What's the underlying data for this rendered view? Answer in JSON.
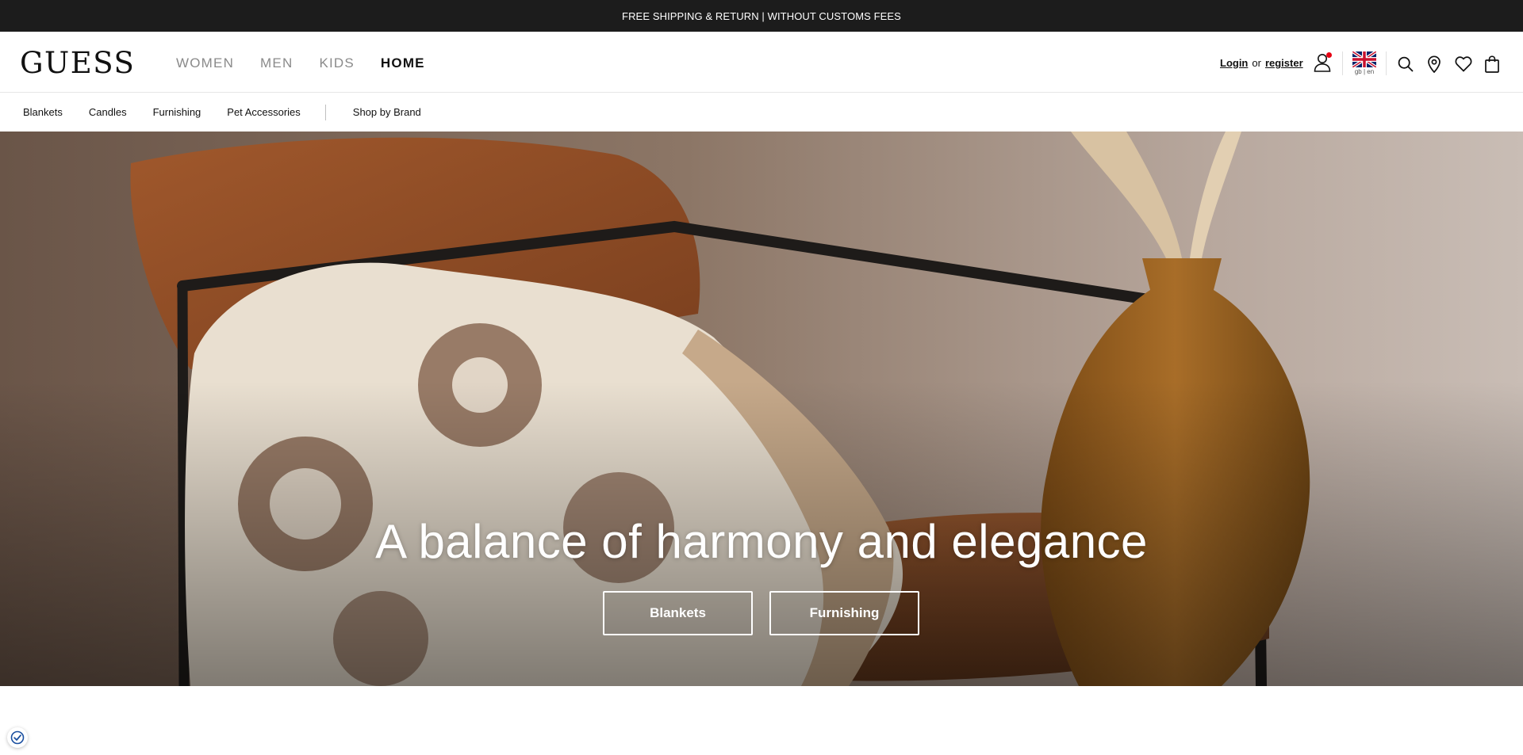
{
  "promo": {
    "text": "FREE SHIPPING & RETURN | WITHOUT CUSTOMS FEES"
  },
  "header": {
    "logo": "GUESS",
    "nav": [
      {
        "label": "WOMEN",
        "active": false
      },
      {
        "label": "MEN",
        "active": false
      },
      {
        "label": "KIDS",
        "active": false
      },
      {
        "label": "HOME",
        "active": true
      }
    ],
    "account": {
      "login": "Login",
      "or": "or",
      "register": "register"
    },
    "locale": {
      "label": "gb | en",
      "flag": "uk-flag-icon"
    },
    "icons": [
      "user-icon",
      "search-icon",
      "location-icon",
      "heart-icon",
      "bag-icon"
    ]
  },
  "subnav": {
    "items": [
      "Blankets",
      "Candles",
      "Furnishing",
      "Pet Accessories"
    ],
    "brand": "Shop by Brand"
  },
  "hero": {
    "title": "A balance of harmony and elegance",
    "buttons": [
      "Blankets",
      "Furnishing"
    ]
  },
  "colors": {
    "promo_bg": "#1c1c1c",
    "notification_dot": "#e60012",
    "active_nav": "#111111",
    "inactive_nav": "#8a8a8a"
  }
}
